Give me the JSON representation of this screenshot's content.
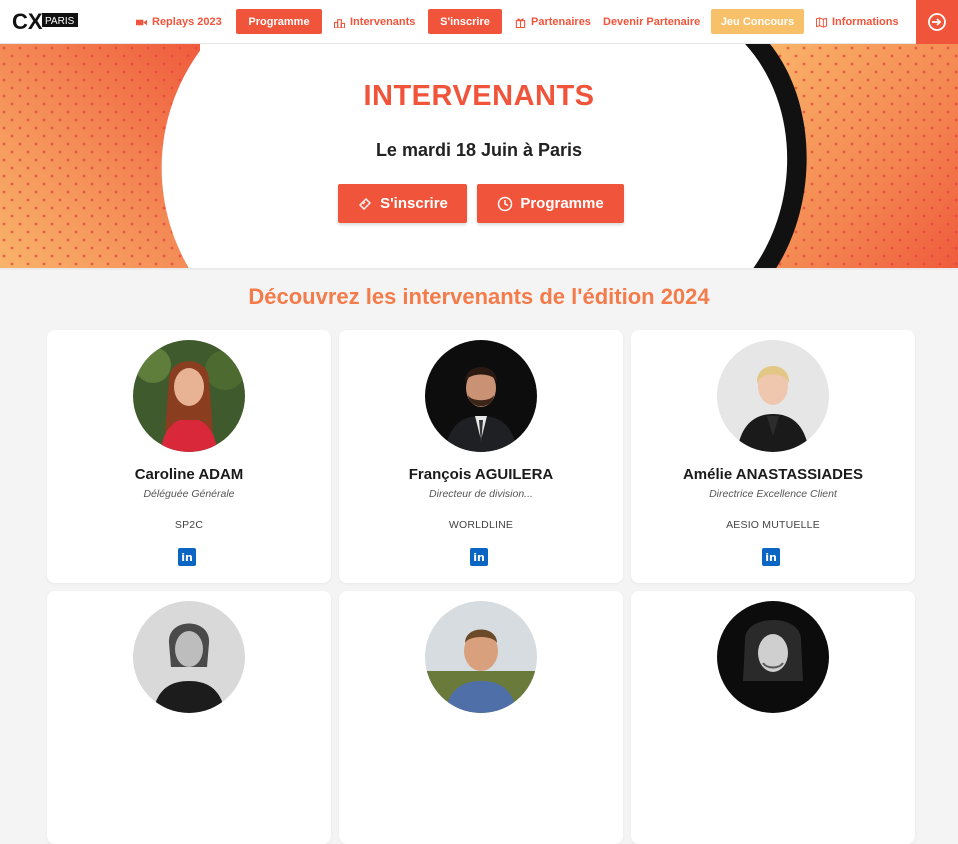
{
  "nav": {
    "logo_text": "CX PARIS",
    "items": [
      {
        "label": "Replays 2023",
        "icon": "video-camera-icon",
        "style": "link"
      },
      {
        "label": "Programme",
        "style": "button"
      },
      {
        "label": "Intervenants",
        "icon": "podium-icon",
        "style": "link"
      },
      {
        "label": "S'inscrire",
        "style": "button"
      },
      {
        "label": "Partenaires",
        "icon": "gift-icon",
        "style": "link"
      },
      {
        "label": "Devenir Partenaire",
        "style": "link"
      },
      {
        "label": "Jeu Concours",
        "style": "button-yellow"
      },
      {
        "label": "Informations",
        "icon": "map-icon",
        "style": "link"
      }
    ],
    "login_icon": "login-arrow-icon"
  },
  "hero": {
    "title": "INTERVENANTS",
    "date": "Le mardi 18 Juin à Paris",
    "btn_register": "S'inscrire",
    "btn_program": "Programme"
  },
  "section": {
    "title": "Découvrez les intervenants de l'édition 2024"
  },
  "speakers": [
    {
      "name": "Caroline ADAM",
      "role": "Déléguée Générale",
      "company": "SP2C"
    },
    {
      "name": "François AGUILERA",
      "role": "Directeur de division...",
      "company": "WORLDLINE"
    },
    {
      "name": "Amélie ANASTASSIADES",
      "role": "Directrice Excellence Client",
      "company": "AESIO MUTUELLE"
    },
    {
      "name": "",
      "role": "",
      "company": ""
    },
    {
      "name": "",
      "role": "",
      "company": ""
    },
    {
      "name": "",
      "role": "",
      "company": ""
    }
  ],
  "colors": {
    "accent": "#f0543a",
    "title_orange": "#f47b4a",
    "yellow": "#f9c06a",
    "linkedin": "#0a66c2"
  }
}
